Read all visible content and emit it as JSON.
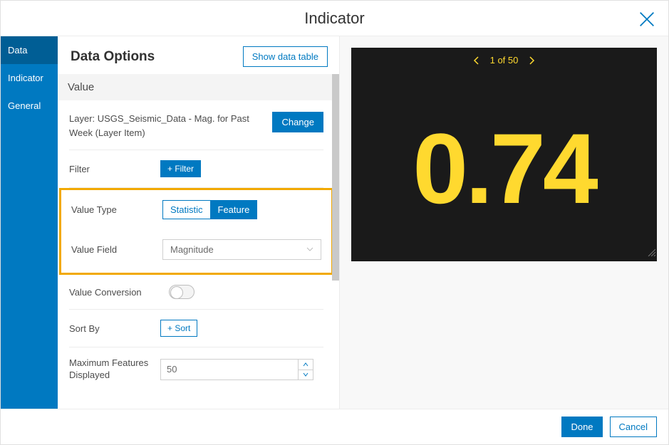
{
  "header": {
    "title": "Indicator"
  },
  "sidebar": {
    "tabs": [
      {
        "label": "Data",
        "active": true
      },
      {
        "label": "Indicator",
        "active": false
      },
      {
        "label": "General",
        "active": false
      }
    ]
  },
  "panel": {
    "title": "Data Options",
    "show_table_label": "Show data table",
    "value_section_label": "Value",
    "layer_text": "Layer: USGS_Seismic_Data - Mag. for Past Week (Layer Item)",
    "change_label": "Change",
    "filter_label": "Filter",
    "filter_button": "+ Filter",
    "value_type_label": "Value Type",
    "value_type_options": {
      "statistic": "Statistic",
      "feature": "Feature"
    },
    "value_type_selected": "feature",
    "value_field_label": "Value Field",
    "value_field_selected": "Magnitude",
    "value_conversion_label": "Value Conversion",
    "sort_by_label": "Sort By",
    "sort_button": "+ Sort",
    "max_features_label": "Maximum Features Displayed",
    "max_features_value": "50"
  },
  "preview": {
    "pager": "1 of 50",
    "value": "0.74"
  },
  "footer": {
    "done": "Done",
    "cancel": "Cancel"
  }
}
